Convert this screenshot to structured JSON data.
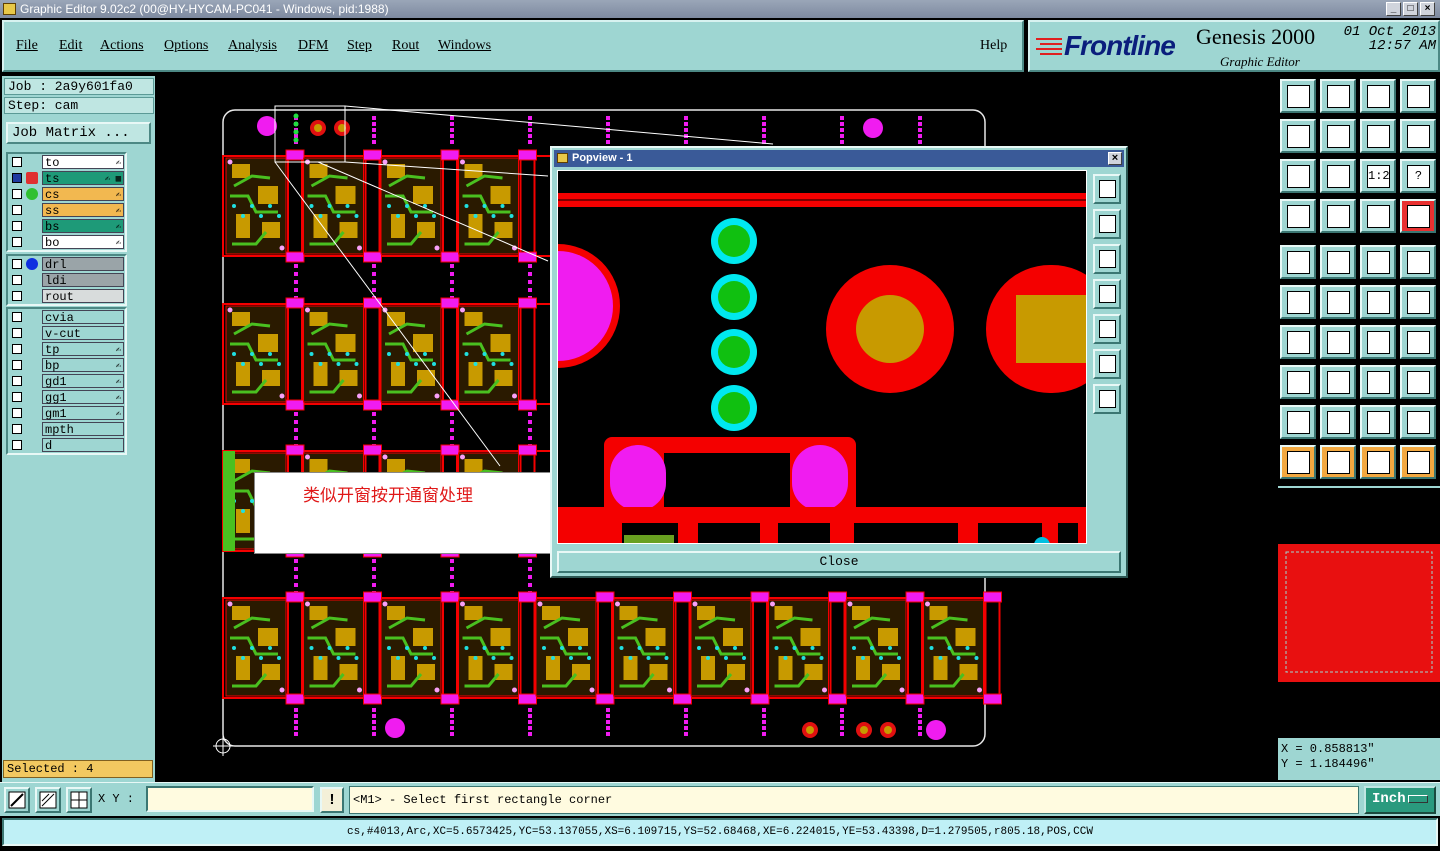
{
  "window": {
    "title": "Graphic Editor 9.02c2 (00@HY-HYCAM-PC041 - Windows, pid:1988)"
  },
  "menu": {
    "items": [
      "File",
      "Edit",
      "Actions",
      "Options",
      "Analysis",
      "DFM",
      "Step",
      "Rout",
      "Windows"
    ],
    "help": "Help"
  },
  "brand": {
    "logo": "Frontline",
    "product": "Genesis 2000",
    "subtitle": "Graphic Editor",
    "date": "01 Oct 2013",
    "time": "12:57 AM"
  },
  "job": {
    "job_line": "Job : 2a9y601fa0",
    "step_line": "Step: cam",
    "matrix_button": "Job Matrix ..."
  },
  "layers": {
    "group1": [
      {
        "name": "to",
        "color": "#ffffff",
        "sym": "✍"
      },
      {
        "name": "ts",
        "color": "#1e9a78",
        "sym": "✍ ▦"
      },
      {
        "name": "cs",
        "color": "#f2b850",
        "sym": "✍"
      },
      {
        "name": "ss",
        "color": "#f2b850",
        "sym": "✍"
      },
      {
        "name": "bs",
        "color": "#1e9a78",
        "sym": "✍"
      },
      {
        "name": "bo",
        "color": "#ffffff",
        "sym": "✍"
      }
    ],
    "group2": [
      {
        "name": "drl",
        "color": "#9aa4a8",
        "sym": ""
      },
      {
        "name": "ldi",
        "color": "#9aa4a8",
        "sym": ""
      },
      {
        "name": "rout",
        "color": "#d8dcdc",
        "sym": ""
      }
    ],
    "group3": [
      {
        "name": "cvia",
        "color": "#9ed6d2",
        "sym": ""
      },
      {
        "name": "v-cut",
        "color": "#9ed6d2",
        "sym": ""
      },
      {
        "name": "tp",
        "color": "#9ed6d2",
        "sym": "✍"
      },
      {
        "name": "bp",
        "color": "#9ed6d2",
        "sym": "✍"
      },
      {
        "name": "gd1",
        "color": "#9ed6d2",
        "sym": "✍"
      },
      {
        "name": "gg1",
        "color": "#9ed6d2",
        "sym": "✍"
      },
      {
        "name": "gm1",
        "color": "#9ed6d2",
        "sym": "✍"
      },
      {
        "name": "mpth",
        "color": "#9ed6d2",
        "sym": ""
      },
      {
        "name": "d",
        "color": "#9ed6d2",
        "sym": ""
      }
    ]
  },
  "selected": "Selected : 4",
  "popview": {
    "title": "Popview - 1",
    "close_label": "Close",
    "close_icon": "×"
  },
  "note": "类似开窗按开通窗处理",
  "coords": {
    "x": "X = 0.858813\"",
    "y": "Y = 1.184496\""
  },
  "command": {
    "xy_label": "X Y :",
    "xy_value": "",
    "bang": "!",
    "prompt": "<M1> - Select first rectangle corner",
    "unit": "Inch"
  },
  "status": "cs,#4013,Arc,XC=5.6573425,YC=53.137055,XS=6.109715,YS=52.68468,XE=6.224015,YE=53.43398,D=1.279505,r805.18,POS,CCW",
  "toolbox": {
    "grid_buttons": [
      "layer-up-icon",
      "layer-down-icon",
      "home-icon",
      "fit-icon",
      "zoom-in-icon",
      "zoom-out-icon",
      "redraw-icon",
      "pan-icon",
      "center-icon",
      "zoom-box-icon",
      "scale-1-2-icon",
      "help-icon",
      "measure-icon",
      "grid-icon",
      "snap-icon",
      "snap-active-icon"
    ],
    "edit_buttons": [
      "pad-icon",
      "line-icon",
      "ruler-icon",
      "select-rect-icon",
      "connect-icon",
      "delete-icon",
      "move-icon",
      "copy-icon",
      "angle-icon",
      "draw-icon",
      "arc-icon",
      "rotate-icon",
      "pad-add-icon",
      "measure-line-icon",
      "dimension-icon",
      "fill-icon",
      "surface-icon",
      "surface-edit-icon",
      "surface-arc-icon",
      "surface-cut-icon",
      "cursor-icon",
      "cursor-select-icon",
      "cursor-box-icon",
      "net-icon"
    ],
    "popup_buttons": [
      "zoom-window-icon",
      "pan-up-icon",
      "pan-down-icon",
      "pan-left-icon",
      "pan-right-icon",
      "expand-icon",
      "fit-page-icon"
    ]
  }
}
